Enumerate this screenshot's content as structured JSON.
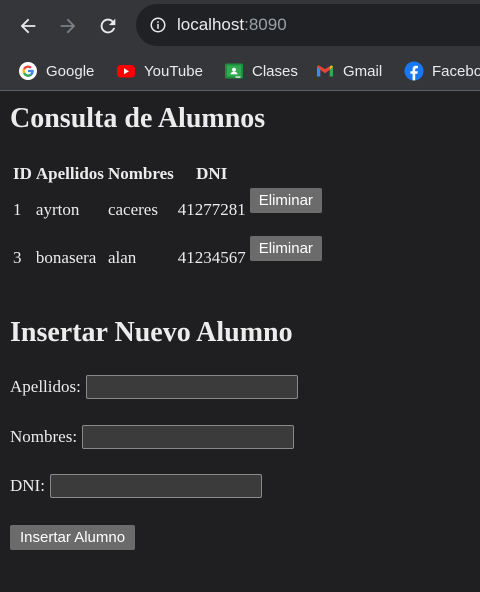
{
  "browser": {
    "url_host": "localhost",
    "url_port": ":8090",
    "bookmarks": [
      {
        "label": "Google",
        "icon": "google-icon"
      },
      {
        "label": "YouTube",
        "icon": "youtube-icon"
      },
      {
        "label": "Clases",
        "icon": "classroom-icon"
      },
      {
        "label": "Gmail",
        "icon": "gmail-icon"
      },
      {
        "label": "Facebo",
        "icon": "facebook-icon"
      }
    ]
  },
  "consulta": {
    "title": "Consulta de Alumnos",
    "columns": [
      "ID",
      "Apellidos",
      "Nombres",
      "DNI"
    ],
    "rows": [
      {
        "id": "1",
        "apellidos": "ayrton",
        "nombres": "caceres",
        "dni": "41277281",
        "action": "Eliminar"
      },
      {
        "id": "3",
        "apellidos": "bonasera",
        "nombres": "alan",
        "dni": "41234567",
        "action": "Eliminar"
      }
    ]
  },
  "insertar": {
    "title": "Insertar Nuevo Alumno",
    "apellidos_label": "Apellidos:",
    "apellidos_value": "",
    "nombres_label": "Nombres:",
    "nombres_value": "",
    "dni_label": "DNI:",
    "dni_value": "",
    "submit_label": "Insertar Alumno"
  },
  "colors": {
    "page_bg": "#1f1f21",
    "chrome_bg": "#35363a",
    "button_bg": "#6b6b6b"
  }
}
